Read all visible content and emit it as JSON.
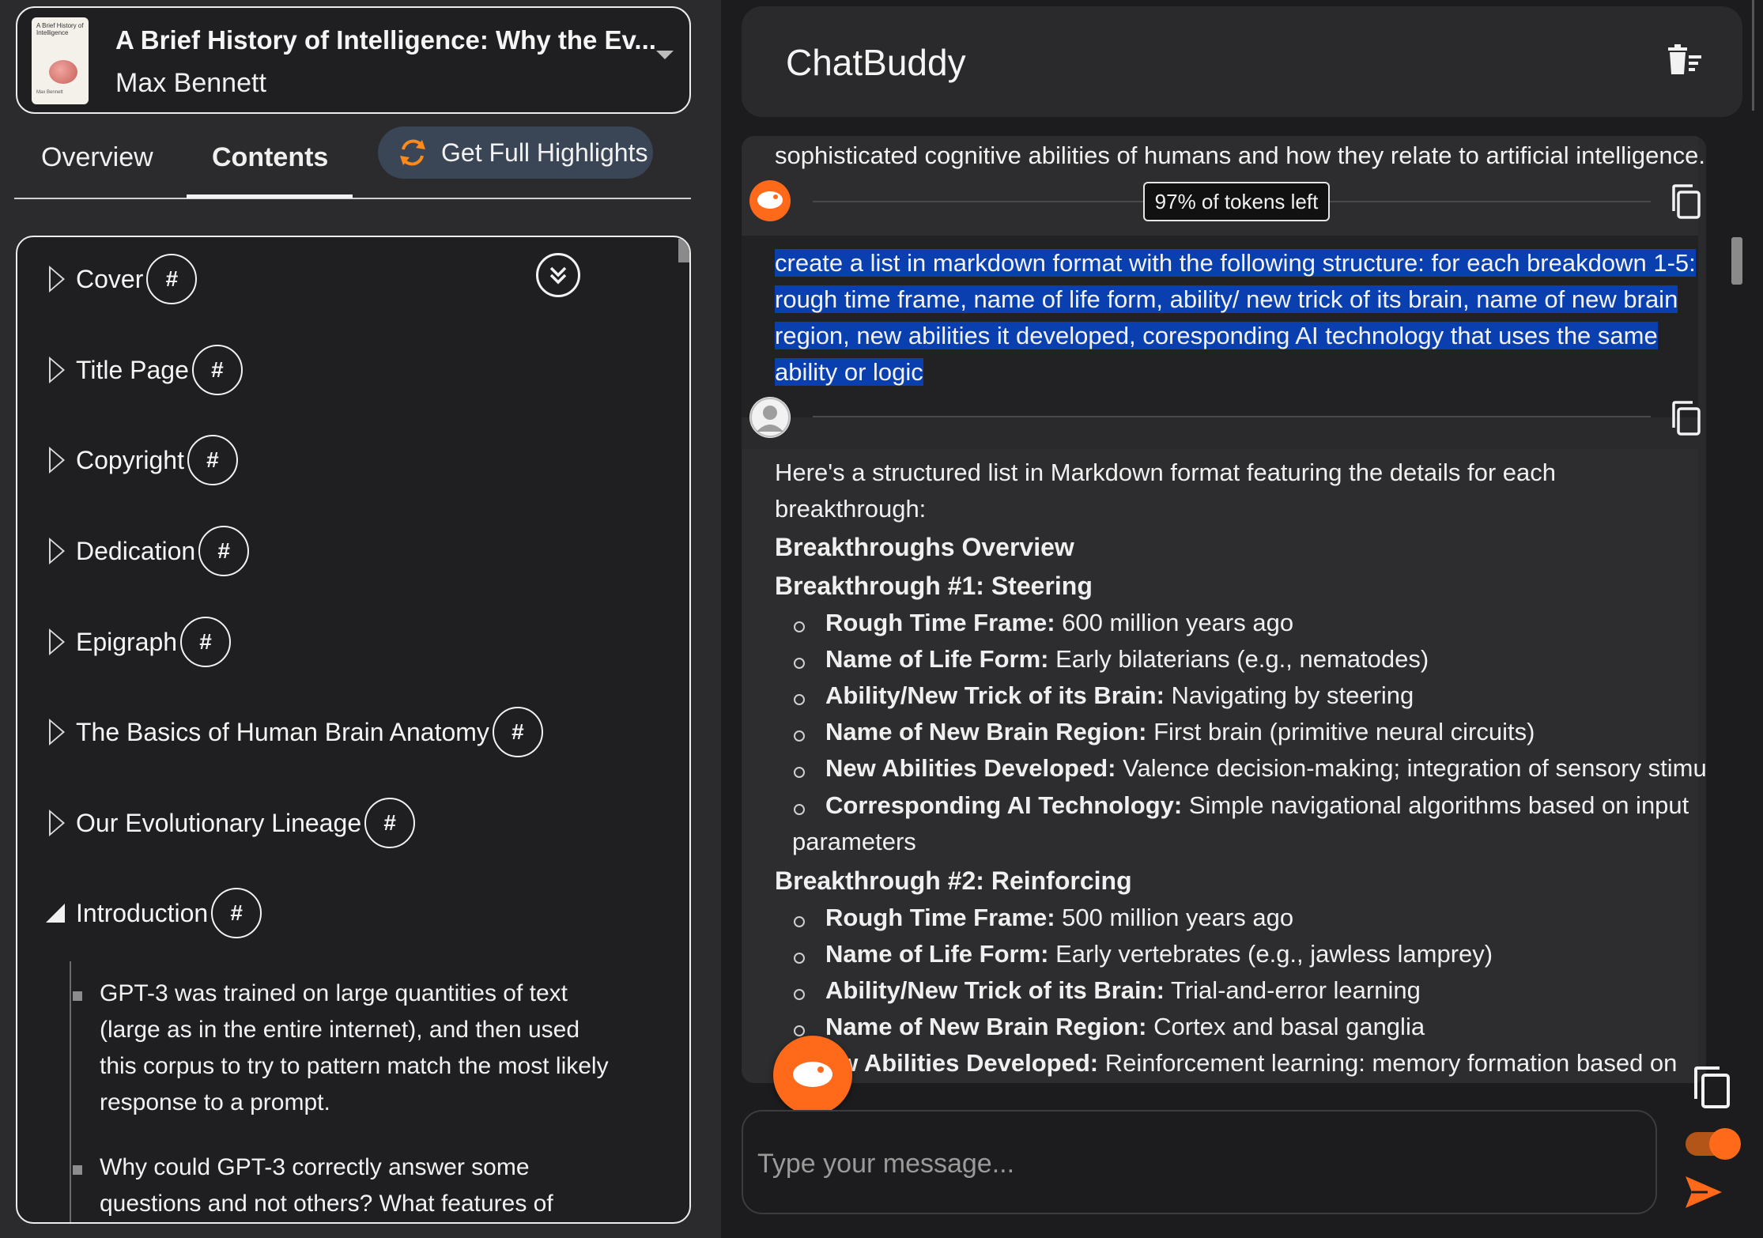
{
  "book": {
    "title": "A Brief History of Intelligence: Why the Ev...",
    "author": "Max Bennett",
    "cover_title": "A Brief History of Intelligence",
    "cover_author": "Max Bennett"
  },
  "tabs": {
    "overview": "Overview",
    "contents": "Contents",
    "active": "Contents"
  },
  "highlights_button": "Get Full Highlights",
  "toc": {
    "hash": "#",
    "items": [
      {
        "label": "Cover"
      },
      {
        "label": "Title Page"
      },
      {
        "label": "Copyright"
      },
      {
        "label": "Dedication"
      },
      {
        "label": "Epigraph"
      },
      {
        "label": "The Basics of Human Brain Anatomy"
      },
      {
        "label": "Our Evolutionary Lineage"
      },
      {
        "label": "Introduction",
        "expanded": true
      }
    ],
    "intro_bullets": [
      "GPT-3 was trained on large quantities of text (large as in the entire internet), and then used this corpus to try to pattern match the most likely response to a prompt.",
      "Why could GPT-3 correctly answer some questions and not others? What features of"
    ]
  },
  "chat": {
    "title": "ChatBuddy",
    "prev_message_tail": "sophisticated cognitive abilities of humans and how they relate to artificial intelligence.",
    "tokens_left": "97% of tokens left",
    "user_message": "create a list in markdown format with the following structure: for each breakdown 1-5: rough time frame, name of life form, ability/ new trick of its brain, name of new brain region, new abilities it developed, coresponding AI technology that uses the same ability or logic",
    "user_lines": [
      "create a list in markdown format with the following structure: for each breakdown 1-5:",
      "rough time frame, name of life form, ability/ new trick of its brain, name of new brain",
      "region, new abilities it developed, coresponding AI technology that uses the same",
      "ability or logic"
    ],
    "reply": {
      "intro_1": "Here's a structured list in Markdown format featuring the details for each",
      "intro_2": "breakthrough:",
      "heading": "Breakthroughs Overview",
      "b1_title": "Breakthrough #1: Steering",
      "b1": [
        {
          "k": "Rough Time Frame:",
          "v": " 600 million years ago"
        },
        {
          "k": "Name of Life Form:",
          "v": " Early bilaterians (e.g., nematodes)"
        },
        {
          "k": "Ability/New Trick of its Brain:",
          "v": " Navigating by steering"
        },
        {
          "k": "Name of New Brain Region:",
          "v": " First brain (primitive neural circuits)"
        },
        {
          "k": "New Abilities Developed:",
          "v": " Valence decision-making; integration of sensory stimuli"
        },
        {
          "k": "Corresponding AI Technology:",
          "v": " Simple navigational algorithms based on input"
        }
      ],
      "b1_wrap": "parameters",
      "b2_title": "Breakthrough #2: Reinforcing",
      "b2": [
        {
          "k": "Rough Time Frame:",
          "v": " 500 million years ago"
        },
        {
          "k": "Name of Life Form:",
          "v": " Early vertebrates (e.g., jawless lamprey)"
        },
        {
          "k": "Ability/New Trick of its Brain:",
          "v": " Trial-and-error learning"
        },
        {
          "k": "Name of New Brain Region:",
          "v": " Cortex and basal ganglia"
        },
        {
          "k": "ew Abilities Developed:",
          "v": " Reinforcement learning: memory formation based on"
        }
      ]
    },
    "input_placeholder": "Type your message...",
    "accent_color": "#ff6a1a",
    "selection_color": "#0a3fb0"
  }
}
